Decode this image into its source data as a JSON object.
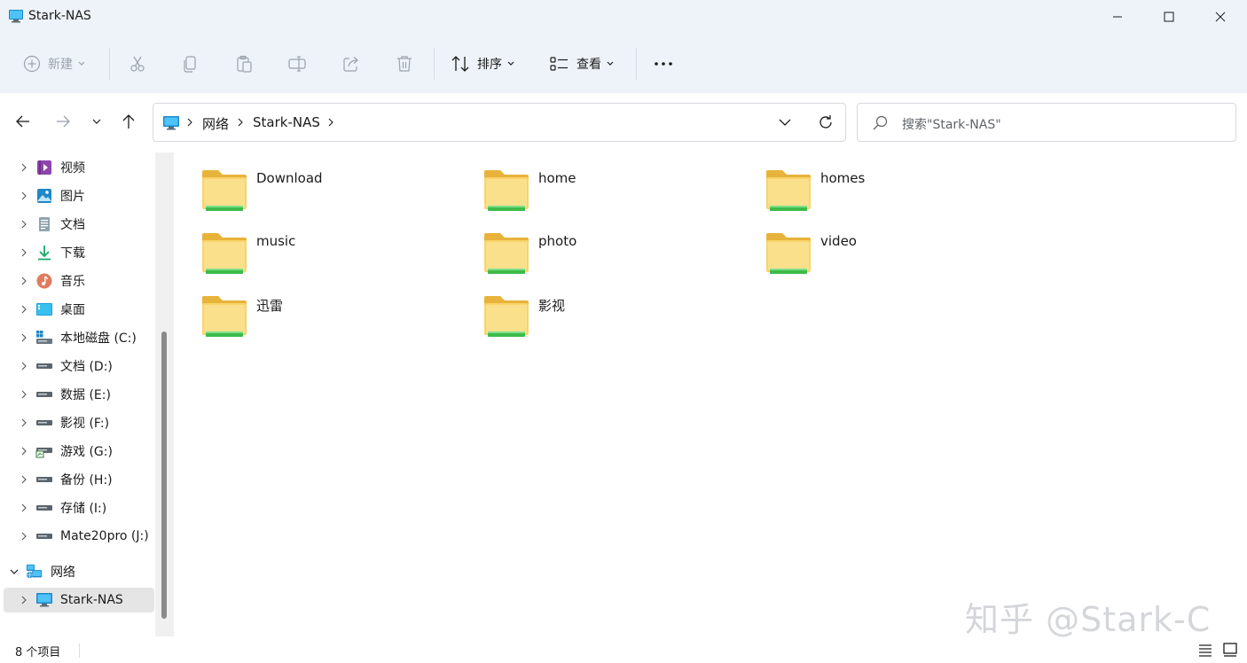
{
  "window": {
    "title": "Stark-NAS"
  },
  "toolbar": {
    "new_label": "新建",
    "sort_label": "排序",
    "view_label": "查看"
  },
  "address": {
    "crumbs": [
      "网络",
      "Stark-NAS"
    ]
  },
  "search": {
    "placeholder": "搜索\"Stark-NAS\""
  },
  "sidebar": {
    "items": [
      {
        "label": "视频",
        "icon": "video-library-icon"
      },
      {
        "label": "图片",
        "icon": "pictures-icon"
      },
      {
        "label": "文档",
        "icon": "documents-icon"
      },
      {
        "label": "下载",
        "icon": "downloads-icon"
      },
      {
        "label": "音乐",
        "icon": "music-icon"
      },
      {
        "label": "桌面",
        "icon": "desktop-icon"
      },
      {
        "label": "本地磁盘 (C:)",
        "icon": "system-drive-icon"
      },
      {
        "label": "文档 (D:)",
        "icon": "drive-icon"
      },
      {
        "label": "数据 (E:)",
        "icon": "drive-icon"
      },
      {
        "label": "影视 (F:)",
        "icon": "drive-icon"
      },
      {
        "label": "游戏 (G:)",
        "icon": "drive-icon"
      },
      {
        "label": "备份 (H:)",
        "icon": "drive-icon"
      },
      {
        "label": "存储 (I:)",
        "icon": "drive-icon"
      },
      {
        "label": "Mate20pro (J:)",
        "icon": "drive-icon"
      },
      {
        "label": "网络",
        "icon": "network-icon"
      },
      {
        "label": "Stark-NAS",
        "icon": "computer-icon"
      }
    ]
  },
  "folders": [
    "Download",
    "home",
    "homes",
    "music",
    "photo",
    "video",
    "迅雷",
    "影视"
  ],
  "status": {
    "count_text": "8 个项目"
  },
  "watermark": "知乎 @Stark-C",
  "colors": {
    "folder": "#f8d46a",
    "folder_strip": "#3dbb4a",
    "selected": "#e5e5e5",
    "chrome": "#eef3f9"
  }
}
